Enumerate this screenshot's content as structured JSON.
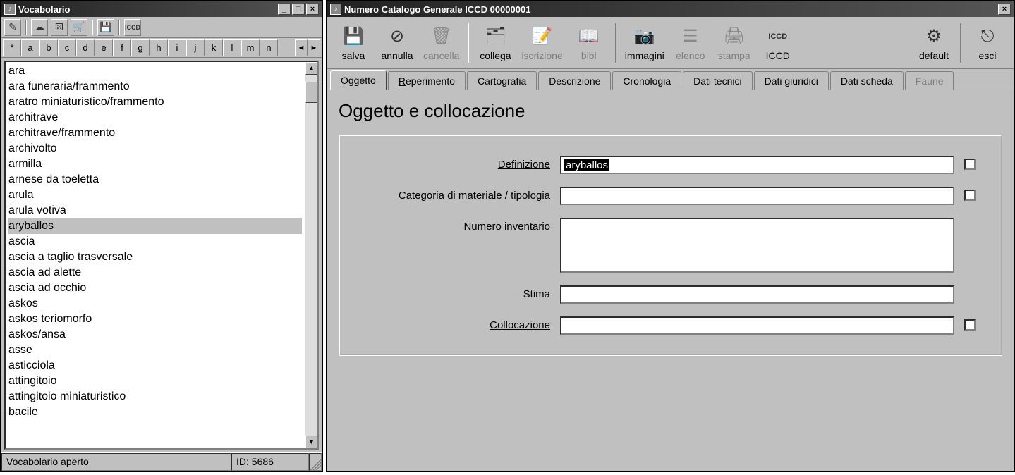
{
  "left_window": {
    "title": "Vocabolario",
    "win_buttons": {
      "min": "_",
      "max": "□",
      "close": "×"
    },
    "toolbar_icons": [
      "tool-a",
      "tool-b",
      "tool-c",
      "tool-d",
      "tool-e",
      "tool-f"
    ],
    "iccd_label": "ICCD",
    "alpha_star": "*",
    "alpha_tabs": [
      "a",
      "b",
      "c",
      "d",
      "e",
      "f",
      "g",
      "h",
      "i",
      "j",
      "k",
      "l",
      "m",
      "n"
    ],
    "arrow_left": "◄",
    "arrow_right": "►",
    "list": [
      "ara",
      "ara funeraria/frammento",
      "aratro miniaturistico/frammento",
      "architrave",
      "architrave/frammento",
      "archivolto",
      "armilla",
      "arnese da toeletta",
      "arula",
      "arula votiva",
      "aryballos",
      "ascia",
      "ascia a taglio trasversale",
      "ascia ad alette",
      "ascia ad occhio",
      "askos",
      "askos teriomorfo",
      "askos/ansa",
      "asse",
      "asticciola",
      "attingitoio",
      "attingitoio miniaturistico",
      "bacile"
    ],
    "selected_index": 10,
    "status_left": "Vocabolario aperto",
    "status_right": "ID: 5686",
    "scroll_up": "▲",
    "scroll_down": "▼"
  },
  "right_window": {
    "title": "Numero Catalogo Generale ICCD 00000001",
    "close": "×",
    "toolbar": [
      {
        "name": "salva",
        "label": "salva",
        "icon": "💾",
        "disabled": false
      },
      {
        "name": "annulla",
        "label": "annulla",
        "icon": "⊘",
        "disabled": false
      },
      {
        "name": "cancella",
        "label": "cancella",
        "icon": "🗑",
        "disabled": true
      },
      {
        "name": "sep",
        "sep": true
      },
      {
        "name": "collega",
        "label": "collega",
        "icon": "🗂",
        "disabled": false
      },
      {
        "name": "iscrizione",
        "label": "iscrizione",
        "icon": "📝",
        "disabled": true
      },
      {
        "name": "bibl",
        "label": "bibl",
        "icon": "📖",
        "disabled": true
      },
      {
        "name": "sep",
        "sep": true
      },
      {
        "name": "immagini",
        "label": "immagini",
        "icon": "📷",
        "disabled": false
      },
      {
        "name": "elenco",
        "label": "elenco",
        "icon": "☰",
        "disabled": true
      },
      {
        "name": "stampa",
        "label": "stampa",
        "icon": "🖨",
        "disabled": true
      },
      {
        "name": "iccd",
        "label": "ICCD",
        "icon": "ICCD",
        "disabled": false
      },
      {
        "name": "spacer",
        "spacer": true
      },
      {
        "name": "default",
        "label": "default",
        "icon": "⚙",
        "disabled": false
      },
      {
        "name": "sep",
        "sep": true
      },
      {
        "name": "esci",
        "label": "esci",
        "icon": "⎋",
        "disabled": false
      }
    ],
    "tabs": [
      {
        "label": "Oggetto",
        "ul": "O",
        "rest": "ggetto",
        "active": true
      },
      {
        "label": "Reperimento",
        "ul": "R",
        "rest": "eperimento"
      },
      {
        "label": "Cartografia"
      },
      {
        "label": "Descrizione"
      },
      {
        "label": "Cronologia"
      },
      {
        "label": "Dati tecnici"
      },
      {
        "label": "Dati giuridici"
      },
      {
        "label": "Dati scheda"
      },
      {
        "label": "Faune",
        "disabled": true
      }
    ],
    "heading": "Oggetto e collocazione",
    "form": {
      "definizione": {
        "label": "Definizione",
        "value": "aryballos",
        "underline": true,
        "check": true
      },
      "categoria": {
        "label": "Categoria di materiale / tipologia",
        "value": "",
        "check": true
      },
      "numero_inv": {
        "label": "Numero inventario",
        "value": "",
        "tall": true
      },
      "stima": {
        "label": "Stima",
        "value": ""
      },
      "collocazione": {
        "label": "Collocazione",
        "value": "",
        "underline": true,
        "check": true
      }
    }
  }
}
